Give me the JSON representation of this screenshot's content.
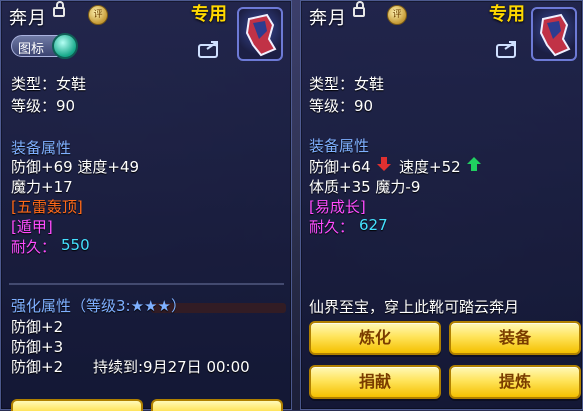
{
  "left_panel": {
    "title": "奔月",
    "ping_badge": "评",
    "special_label": "专用",
    "toggle_label": "图标",
    "type_line": "类型：女鞋",
    "level_line": "等级：90",
    "attr_header": "装备属性",
    "attr_line1": "防御+69 速度+49",
    "attr_line2": "魔力+17",
    "skill1": "[五雷轰顶]",
    "skill2": "[遁甲]",
    "durability_label": "耐久：",
    "durability_value": "550",
    "enhance_header": "强化属性（等级3:★★★）",
    "enhance_line1": "防御+2",
    "enhance_line2": "防御+3",
    "enhance_line3": "防御+2",
    "enhance_duration": "持续到:9月27日 00:00"
  },
  "right_panel": {
    "title": "奔月",
    "ping_badge": "评",
    "special_label": "专用",
    "type_line": "类型：女鞋",
    "level_line": "等级：90",
    "attr_header": "装备属性",
    "attr_defense": "防御+64",
    "attr_speed": "速度+52",
    "attr_line2": "体质+35 魔力-9",
    "skill1": "[易成长]",
    "durability_label": "耐久：",
    "durability_value": "627",
    "description": "仙界至宝，穿上此靴可踏云奔月",
    "buttons": {
      "refine": "炼化",
      "equip": "装备",
      "donate": "捐献",
      "extract": "提炼"
    }
  },
  "colors": {
    "header_blue": "#7fb0ff",
    "special_yellow": "#ffd800",
    "skill_orange": "#ff6a1a",
    "skill_magenta": "#ff4dff",
    "durability_cyan": "#45e2ff",
    "button_gold": "#ffe45c",
    "stat_down_red": "#e03030",
    "stat_up_green": "#20d060"
  },
  "icons": {
    "lock": "lock-icon",
    "share": "share-icon",
    "avatar": "boots-avatar-icon",
    "arrow_down": "arrow-down-icon",
    "arrow_up": "arrow-up-icon"
  }
}
